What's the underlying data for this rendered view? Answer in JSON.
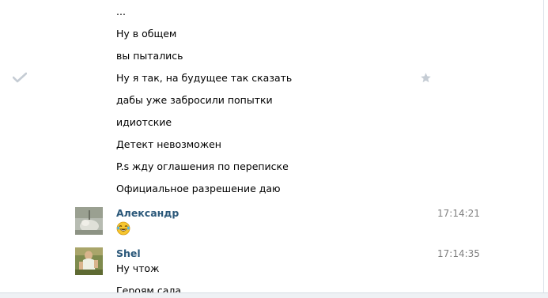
{
  "conversation": {
    "lines": [
      "...",
      "Ну в общем",
      "вы пытались",
      "Ну я так, на будущее так сказать",
      "дабы уже забросили попытки",
      "идиотские",
      "Детект невозможен",
      "P.s жду оглашения по переписке",
      "Официальное разрешение даю"
    ],
    "messages": [
      {
        "author": "Александр",
        "time": "17:14:21",
        "emoji": "laughing-tears-emoji"
      },
      {
        "author": "Shel",
        "time": "17:14:35",
        "lines": [
          "Ну чтож",
          "Героям сала"
        ]
      }
    ]
  },
  "icons": {
    "check": "check-icon",
    "star": "star-icon"
  },
  "colors": {
    "author": "#2b587a",
    "time": "#808080",
    "icon_muted": "#c5ccd4"
  }
}
